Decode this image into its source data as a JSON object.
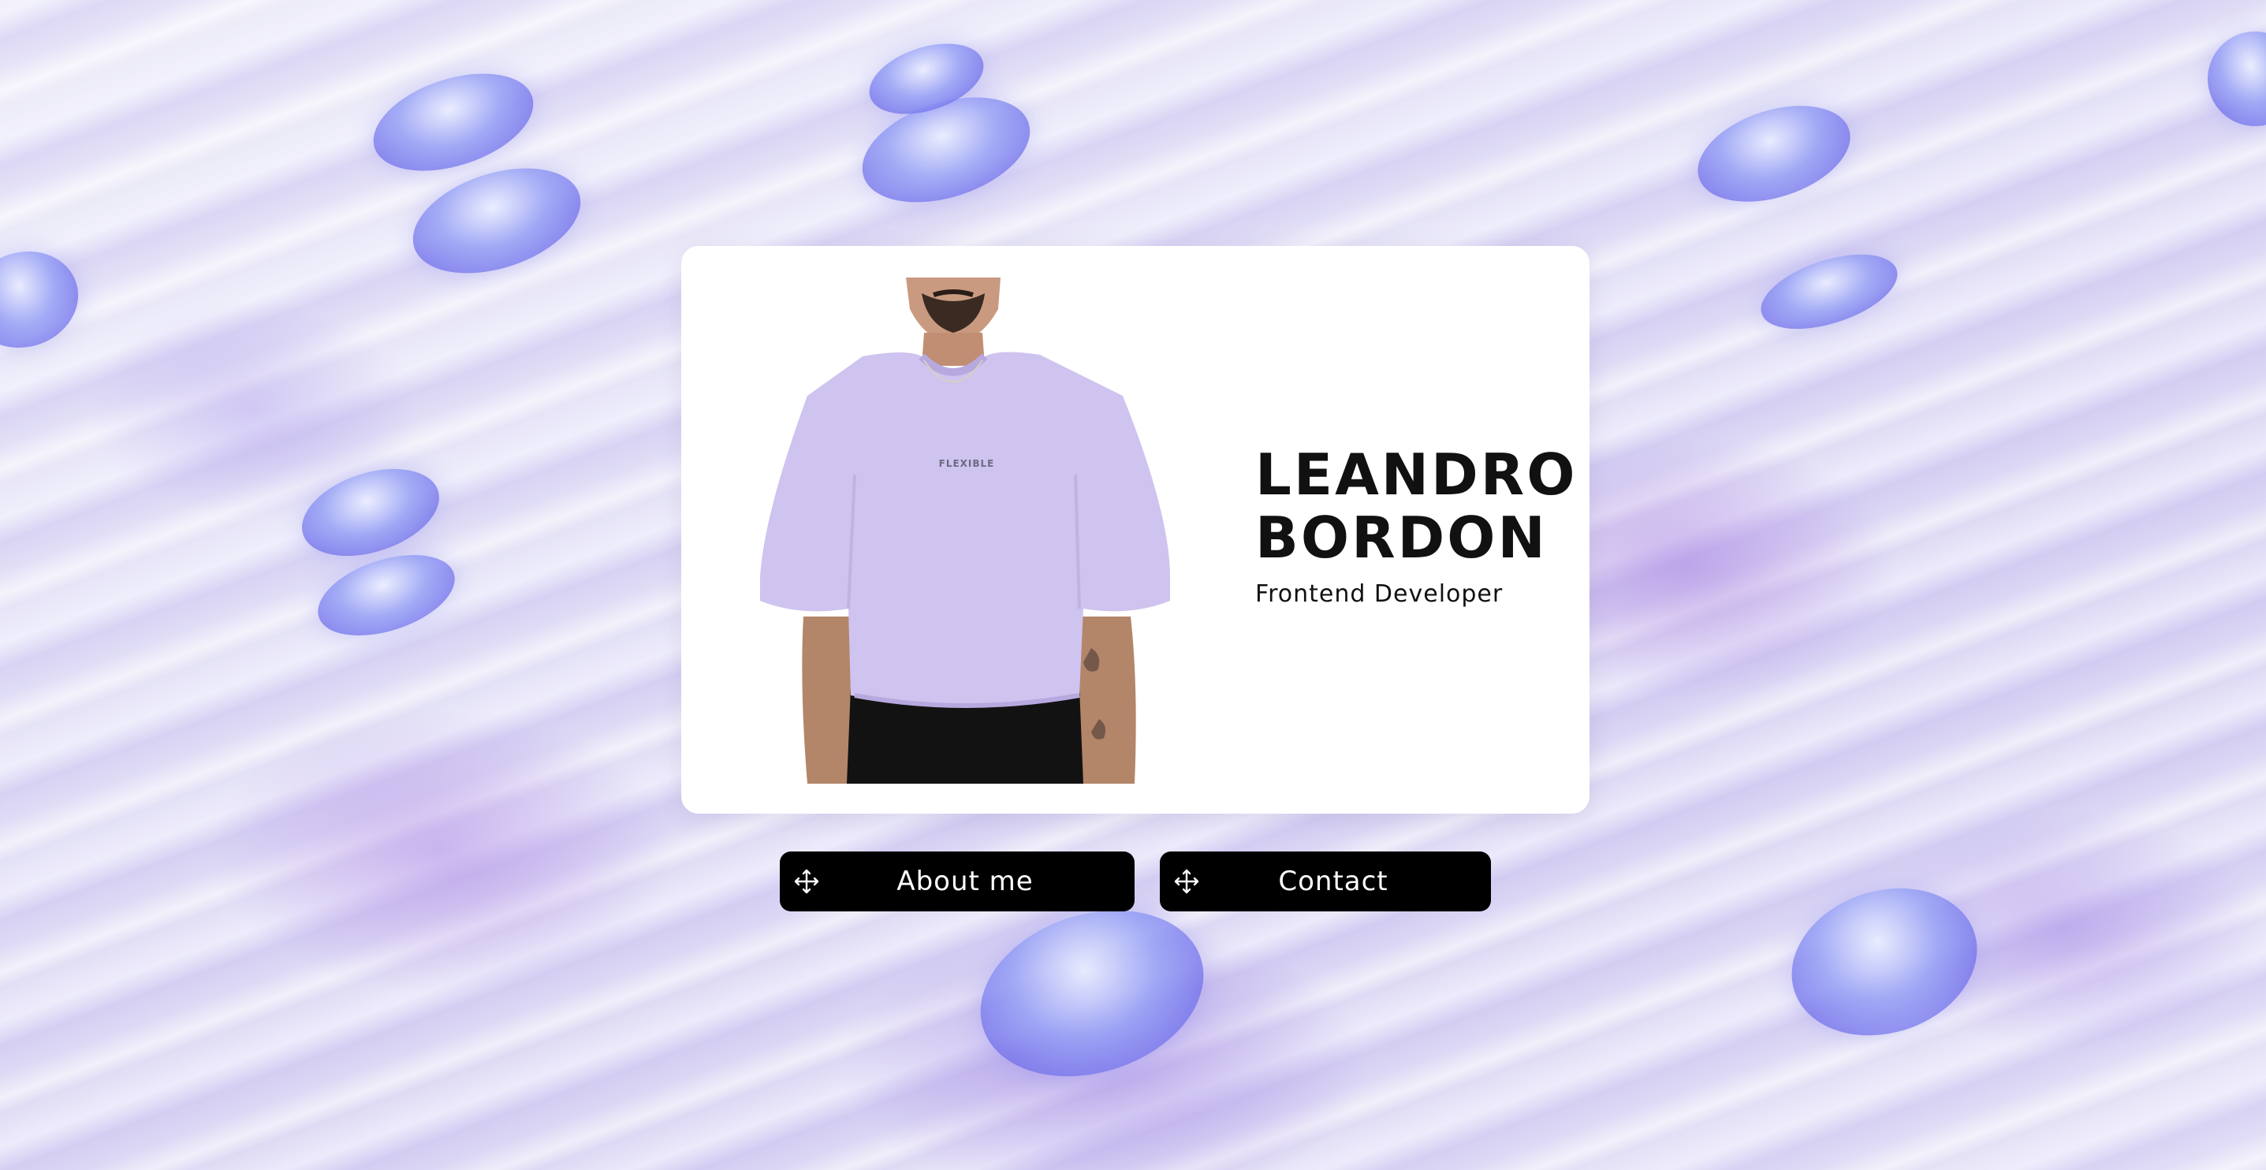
{
  "profile": {
    "first_name": "LEANDRO",
    "last_name": "BORDON",
    "role": "Frontend Developer",
    "shirt_print": "FLEXIBLE"
  },
  "nav": {
    "about_label": "About me",
    "contact_label": "Contact",
    "button_icon": "move-arrows-icon"
  },
  "colors": {
    "card": "#ffffff",
    "button": "#000000",
    "shirt": "#cfc3ef",
    "accent_lavender": "#b7a6ea"
  }
}
